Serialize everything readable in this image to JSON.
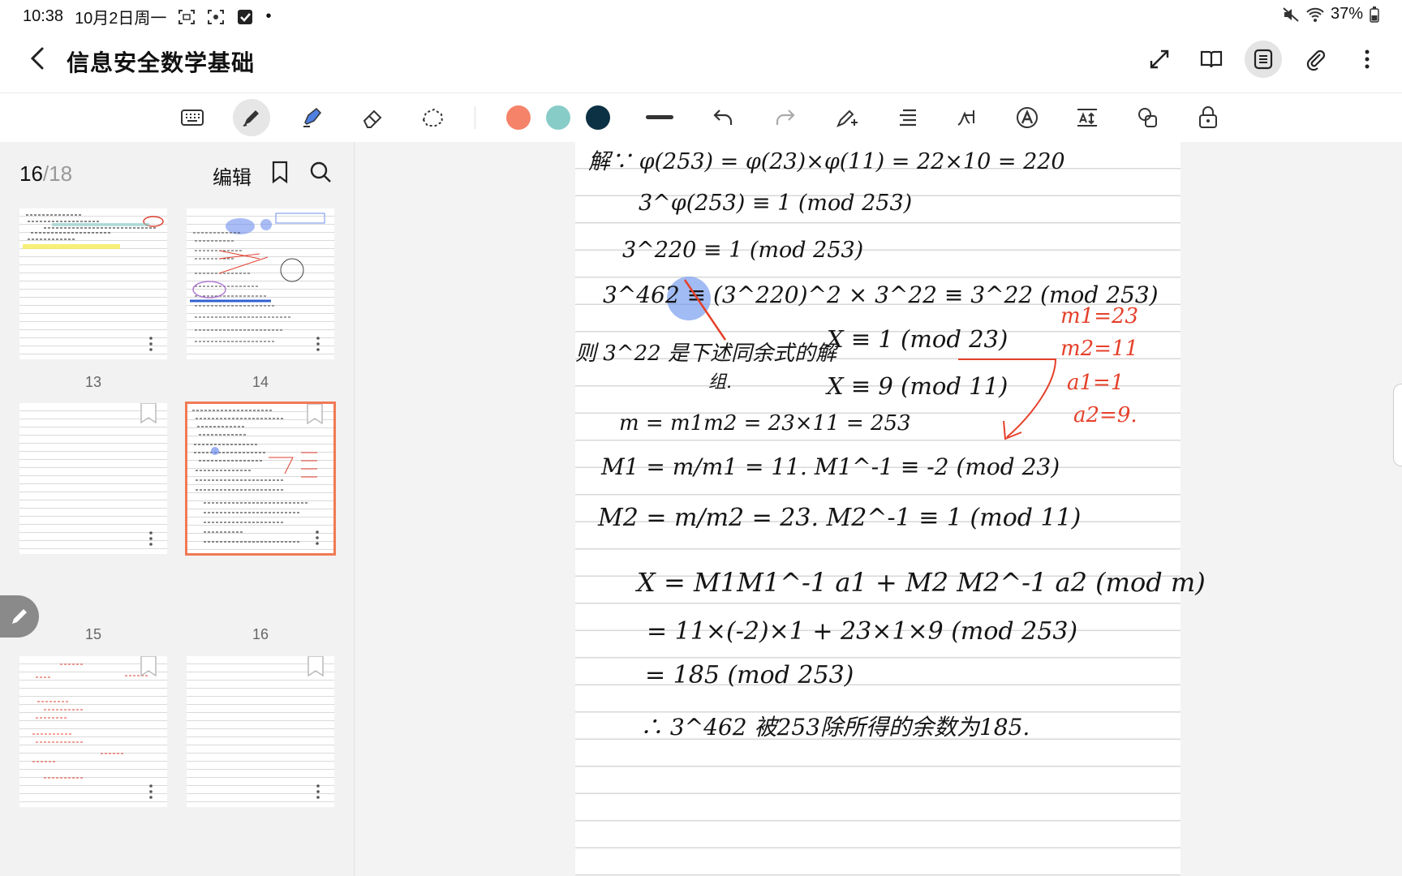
{
  "status": {
    "time": "10:38",
    "date": "10月2日周一",
    "dot": "•",
    "battery": "37%"
  },
  "header": {
    "title": "信息安全数学基础"
  },
  "colors": {
    "swatch1": "#f5836a",
    "swatch2": "#88ccc8",
    "swatch3": "#0c3044",
    "selected_outline": "#f07a55"
  },
  "sidebar": {
    "current_page": "16",
    "total_pages": "/18",
    "edit_label": "编辑",
    "thumbnails": [
      {
        "label": "13"
      },
      {
        "label": "14"
      },
      {
        "label": "15"
      },
      {
        "label": "16"
      }
    ]
  },
  "note": {
    "line1": "解∵ φ(253) = φ(23)×φ(11) = 22×10 = 220",
    "line2": "3^φ(253) ≡ 1 (mod 253)",
    "line3": "3^220 ≡ 1 (mod 253)",
    "line4": "3^462 ≡ (3^220)^2 × 3^22 ≡ 3^22 (mod 253)",
    "line5a": "则 3^22 是下述同余式的解",
    "line5b": "组.",
    "sys1": "X ≡ 1 (mod 23)",
    "sys2": "X ≡ 9 (mod 11)",
    "red1": "m1=23",
    "red2": "m2=11",
    "red3": "a1=1",
    "red4": "a2=9.",
    "line6": "m = m1m2 = 23×11 = 253",
    "line7": "M1 = m/m1 = 11.     M1^-1 ≡ -2 (mod 23)",
    "line8": "M2 = m/m2 = 23.     M2^-1 ≡ 1   (mod 11)",
    "line9": "X = M1M1^-1 a1 + M2 M2^-1 a2 (mod m)",
    "line10": "= 11×(-2)×1 + 23×1×9 (mod 253)",
    "line11": "= 185 (mod 253)",
    "line12": "∴ 3^462 被253除所得的余数为185."
  }
}
